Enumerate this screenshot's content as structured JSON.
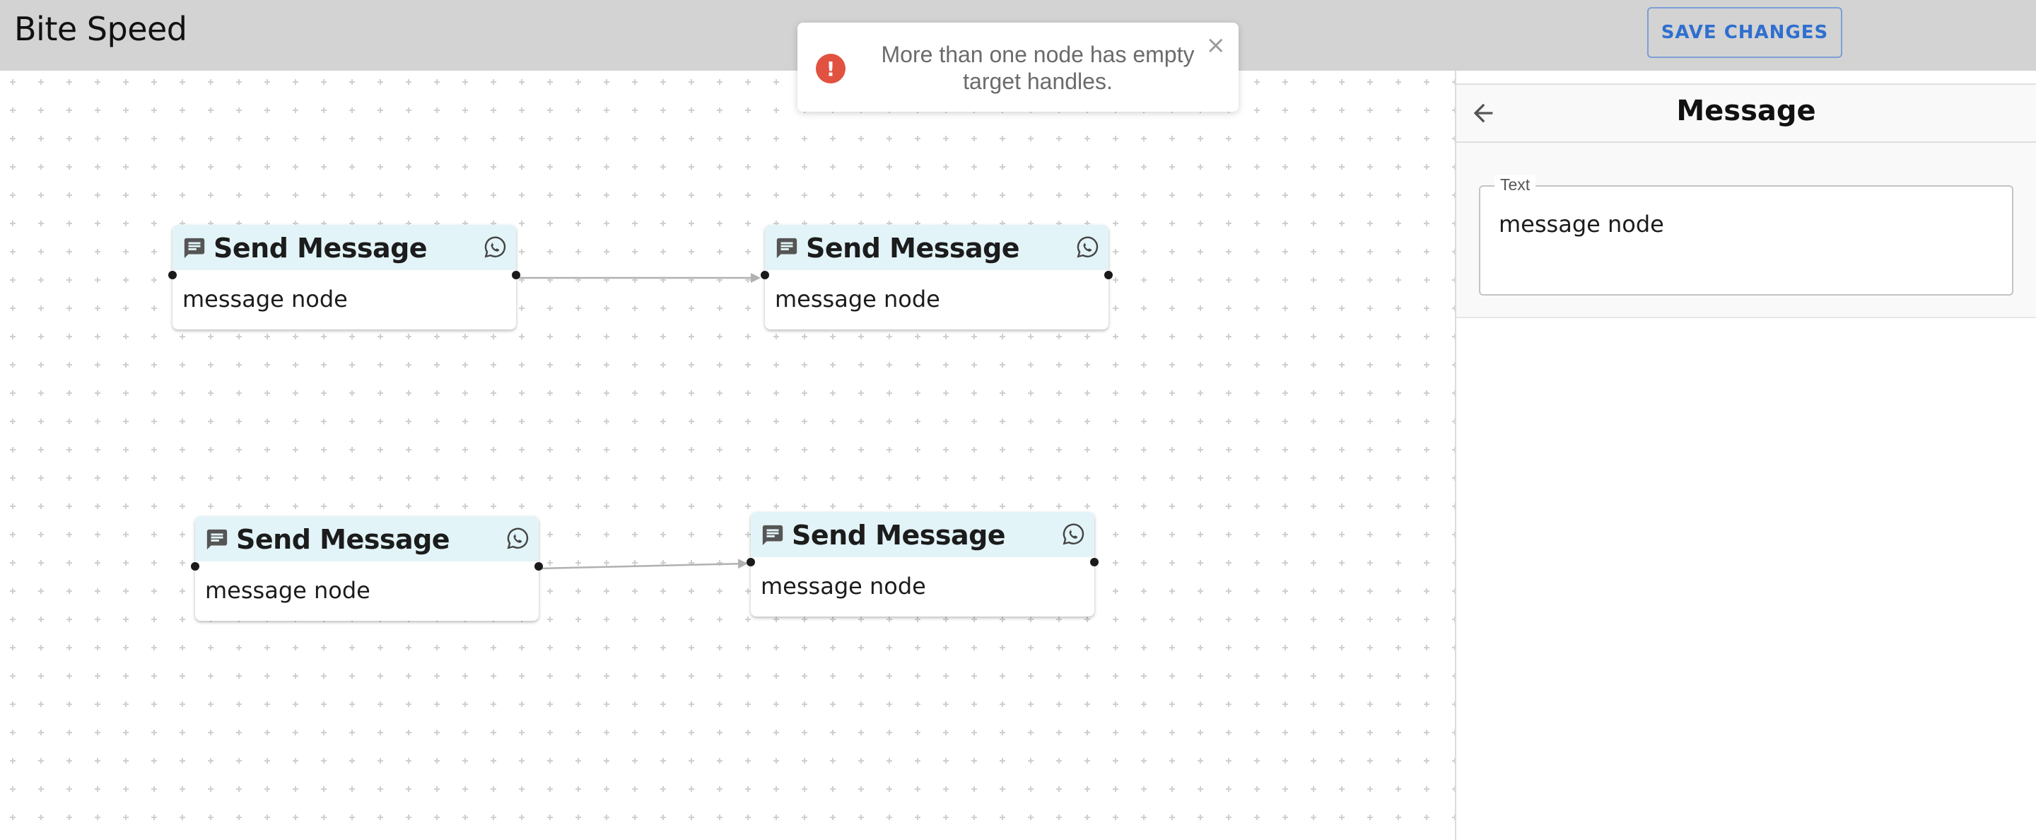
{
  "header": {
    "app_title": "Bite Speed",
    "save_label": "SAVE CHANGES"
  },
  "toast": {
    "message": "More than one node has empty target handles.",
    "close_symbol": "×",
    "icon": "error-icon",
    "icon_color": "#e15241"
  },
  "nodes": [
    {
      "title": "Send Message",
      "text": "message node"
    },
    {
      "title": "Send Message",
      "text": "message node"
    },
    {
      "title": "Send Message",
      "text": "message node"
    },
    {
      "title": "Send Message",
      "text": "message node"
    }
  ],
  "panel": {
    "title": "Message",
    "field_label": "Text",
    "field_value": "message node"
  },
  "colors": {
    "header_bg": "#d3d3d3",
    "node_header_bg": "#e3f4f8",
    "button_accent": "#2f6fcf"
  }
}
